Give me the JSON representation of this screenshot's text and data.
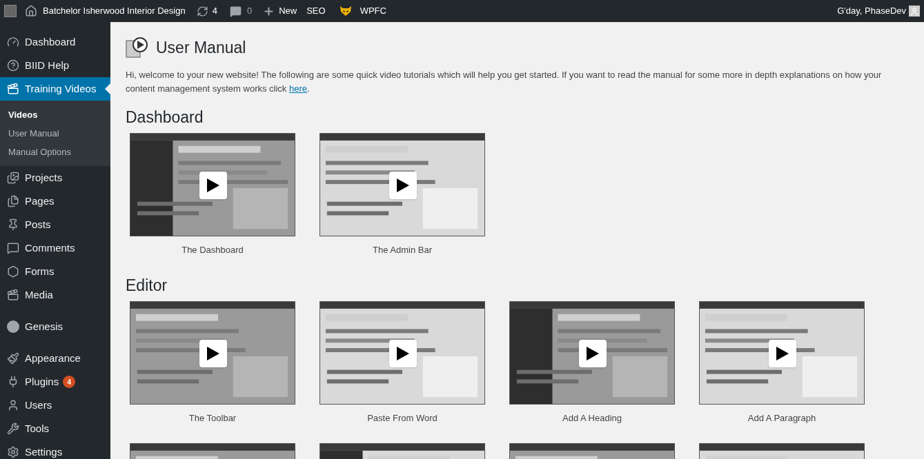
{
  "admin_bar": {
    "site_name": "Batchelor Isherwood Interior Design",
    "updates_count": "4",
    "comments_count": "0",
    "new_label": "New",
    "seo_label": "SEO",
    "wpfc_label": "WPFC",
    "greeting": "G'day, PhaseDev"
  },
  "sidebar": {
    "groups": [
      [
        {
          "label": "Dashboard",
          "selected": false
        },
        {
          "label": "BIID Help",
          "selected": false
        },
        {
          "label": "Training Videos",
          "selected": true,
          "children": [
            {
              "label": "Videos",
              "selected": true
            },
            {
              "label": "User Manual",
              "selected": false
            },
            {
              "label": "Manual Options",
              "selected": false
            }
          ]
        },
        {
          "label": "Projects",
          "selected": false
        },
        {
          "label": "Pages",
          "selected": false
        },
        {
          "label": "Posts",
          "selected": false
        },
        {
          "label": "Comments",
          "selected": false
        },
        {
          "label": "Forms",
          "selected": false
        },
        {
          "label": "Media",
          "selected": false
        }
      ],
      [
        {
          "label": "Genesis",
          "selected": false
        }
      ],
      [
        {
          "label": "Appearance",
          "selected": false
        },
        {
          "label": "Plugins",
          "selected": false,
          "badge": "4"
        },
        {
          "label": "Users",
          "selected": false
        },
        {
          "label": "Tools",
          "selected": false
        },
        {
          "label": "Settings",
          "selected": false
        }
      ]
    ]
  },
  "main": {
    "title": "User Manual",
    "intro": "Hi, welcome to your new website! The following are some quick video tutorials which will help you get started. If you want to read the manual for some more in depth explanations on how your content management system works click",
    "intro_link": "here",
    "intro_end": ".",
    "sections": [
      {
        "heading": "Dashboard",
        "videos": [
          {
            "title": "The Dashboard"
          },
          {
            "title": "The Admin Bar"
          }
        ]
      },
      {
        "heading": "Editor",
        "videos": [
          {
            "title": "The Toolbar"
          },
          {
            "title": "Paste From Word"
          },
          {
            "title": "Add A Heading"
          },
          {
            "title": "Add A Paragraph"
          },
          {
            "kind": "picture"
          },
          {
            "kind": "picture"
          },
          {
            "kind": "picture"
          },
          {
            "kind": "picture"
          }
        ]
      }
    ]
  }
}
